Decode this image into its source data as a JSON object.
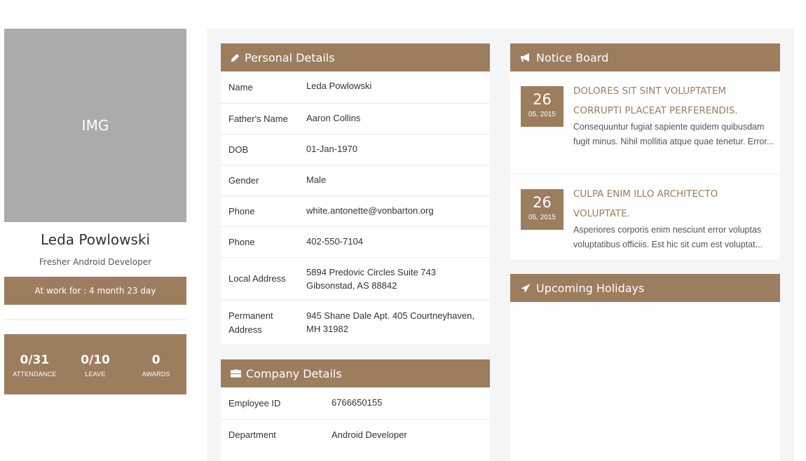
{
  "colors": {
    "accent": "#9c7d5e",
    "image_placeholder": "#ababab",
    "page_bg": "#f5f5f5"
  },
  "profile": {
    "image_placeholder": "IMG",
    "name": "Leda Powlowski",
    "role": "Fresher Android Developer",
    "work_duration": "At work for : 4 month 23 day",
    "stats": [
      {
        "value": "0/31",
        "label": "ATTENDANCE"
      },
      {
        "value": "0/10",
        "label": "LEAVE"
      },
      {
        "value": "0",
        "label": "AWARDS"
      }
    ]
  },
  "personal_details": {
    "title": "Personal Details",
    "icon": "pencil-icon",
    "rows": [
      {
        "label": "Name",
        "value": "Leda Powlowski"
      },
      {
        "label": "Father's Name",
        "value": "Aaron Collins"
      },
      {
        "label": "DOB",
        "value": "01-Jan-1970"
      },
      {
        "label": "Gender",
        "value": "Male"
      },
      {
        "label": "Phone",
        "value": "white.antonette@vonbarton.org"
      },
      {
        "label": "Phone",
        "value": "402-550-7104"
      },
      {
        "label": "Local Address",
        "value": "5894 Predovic Circles Suite 743 Gibsonstad, AS 88842"
      },
      {
        "label": "Permanent Address",
        "value": "945 Shane Dale Apt. 405 Courtneyhaven, MH 31982"
      }
    ]
  },
  "company_details": {
    "title": "Company Details",
    "icon": "briefcase-icon",
    "rows": [
      {
        "label": "Employee ID",
        "value": "6766650155"
      },
      {
        "label": "Department",
        "value": "Android Developer"
      }
    ]
  },
  "notice_board": {
    "title": "Notice Board",
    "icon": "megaphone-icon",
    "items": [
      {
        "day": "26",
        "month_year": "05, 2015",
        "title": "DOLORES SIT SINT VOLUPTATEM CORRUPTI PLACEAT PERFERENDIS.",
        "excerpt": "Consequuntur fugiat sapiente quidem quibusdam fugit minus. Nihil mollitia atque quae tenetur. Error..."
      },
      {
        "day": "26",
        "month_year": "05, 2015",
        "title": "CULPA ENIM ILLO ARCHITECTO VOLUPTATE.",
        "excerpt": "Asperiores corporis enim nesciunt error voluptas voluptatibus officiis. Est hic sit cum est voluptat..."
      }
    ]
  },
  "upcoming_holidays": {
    "title": "Upcoming Holidays",
    "icon": "paper-plane-icon"
  }
}
